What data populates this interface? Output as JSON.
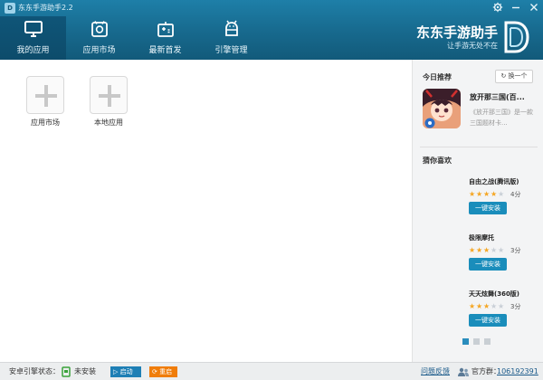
{
  "window": {
    "title": "东东手游助手2.2",
    "logo_text": "D",
    "controls": [
      "settings",
      "minimize",
      "close"
    ]
  },
  "nav": {
    "tabs": [
      {
        "label": "我的应用",
        "icon": "monitor-icon",
        "active": true
      },
      {
        "label": "应用市场",
        "icon": "store-icon",
        "active": false
      },
      {
        "label": "最新首发",
        "icon": "gamepad-icon",
        "active": false
      },
      {
        "label": "引擎管理",
        "icon": "android-icon",
        "active": false
      }
    ]
  },
  "brand": {
    "name": "东东手游助手",
    "slogan": "让手游无处不在"
  },
  "my_apps": {
    "tiles": [
      {
        "label": "应用市场"
      },
      {
        "label": "本地应用"
      }
    ]
  },
  "sidebar": {
    "today": {
      "title": "今日推荐",
      "swap_label": "换一个",
      "featured": {
        "name": "放开那三国(百...",
        "desc": "《放开那三国》是一款三国题材卡..."
      }
    },
    "guess": {
      "title": "猜你喜欢",
      "items": [
        {
          "name": "自由之战(腾讯版)",
          "stars": 4,
          "score": "4分",
          "install_label": "一键安装"
        },
        {
          "name": "极限摩托",
          "stars": 3,
          "score": "3分",
          "install_label": "一键安装"
        },
        {
          "name": "天天炫舞(360版)",
          "stars": 3,
          "score": "3分",
          "install_label": "一键安装"
        }
      ],
      "page_count": 3,
      "active_page": 1
    }
  },
  "status_bar": {
    "engine_label": "安卓引擎状态：",
    "engine_state": "未安装",
    "start_label": "启动",
    "restart_label": "重启",
    "feedback_label": "问题反馈",
    "group_label": "官方群：",
    "group_number": "106192391"
  },
  "colors": {
    "header": "#17698d",
    "active_tab": "#0d4c6b",
    "install_button": "#1a8dbb",
    "restart_button": "#f07d0a",
    "start_button": "#1e7fb5",
    "star_on": "#f5a623",
    "star_off": "#c9cfd6"
  }
}
